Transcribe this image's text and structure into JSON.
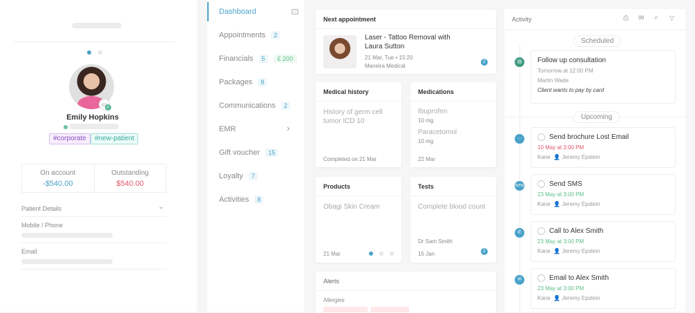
{
  "patient": {
    "name": "Emily Hopkins",
    "tags": [
      "#corporate",
      "#new-patient"
    ],
    "on_account_label": "On account",
    "on_account": "-$540.00",
    "outstanding_label": "Outstanding",
    "outstanding": "$540.00",
    "details_label": "Patient Details",
    "mobile_label": "Mobile / Phone",
    "email_label": "Email"
  },
  "nav": {
    "items": [
      {
        "label": "Dashboard"
      },
      {
        "label": "Appointments",
        "count": "2"
      },
      {
        "label": "Financials",
        "count": "5",
        "amount": "£ 200"
      },
      {
        "label": "Packages",
        "count": "8"
      },
      {
        "label": "Communications",
        "count": "2"
      },
      {
        "label": "EMR"
      },
      {
        "label": "Gift voucher",
        "count": "15"
      },
      {
        "label": "Loyalty",
        "count": "7"
      },
      {
        "label": "Activities",
        "count": "8"
      }
    ]
  },
  "next_appointment": {
    "title": "Next appointment",
    "service": "Laser - Tattoo Removal with Laura Sutton",
    "datetime": "21 Mar, Tue • 15:20",
    "location": "Maneira Medical",
    "count": "2"
  },
  "medical_history": {
    "title": "Medical history",
    "text": "History of germ cell tumor ICD 10",
    "footer": "Completed on 21 Mar"
  },
  "medications": {
    "title": "Medications",
    "items": [
      {
        "name": "Ibuprofen",
        "dose": "10 mg"
      },
      {
        "name": "Paracetomol",
        "dose": "10 mg"
      }
    ],
    "footer": "22 Mar"
  },
  "products": {
    "title": "Products",
    "text": "Obagi Skin Cream",
    "footer": "21 Mar"
  },
  "tests": {
    "title": "Tests",
    "text": "Complete blood count",
    "doctor": "Dr Sam Smith",
    "footer": "15 Jan",
    "count": "2"
  },
  "alerts": {
    "title": "Alerts",
    "allergies": "Allergies"
  },
  "activity": {
    "title": "Activity",
    "scheduled": "Scheduled",
    "upcoming": "Upcoming",
    "scheduled_item": {
      "title": "Follow up consultation",
      "time": "Tomorrow at 12:00 PM",
      "who": "Martin Wade",
      "note": "Client wants to pay by card"
    },
    "items": [
      {
        "title": "Send brochure Lost Email",
        "time": "10 May at 3:00 PM",
        "owner": "Kane",
        "assignee": "Jeremy Epstein",
        "icon": "chat-icon"
      },
      {
        "title": "Send SMS",
        "time": "23 May at 3:00 PM",
        "owner": "Kane",
        "assignee": "Jeremy Epstein",
        "icon": "sms-icon"
      },
      {
        "title": "Call to Alex Smith",
        "time": "23 May at 3:00 PM",
        "owner": "Kane",
        "assignee": "Jeremy Epstein",
        "icon": "phone-icon"
      },
      {
        "title": "Email to Alex Smith",
        "time": "23 May at 3:00 PM",
        "owner": "Kane",
        "assignee": "Jeremy Epstein",
        "icon": "envelope-icon"
      }
    ]
  },
  "colors": {
    "accent": "#4aa2c9",
    "danger": "#e0566a",
    "success": "#5bbd88",
    "calendar": "#3f9a80"
  }
}
